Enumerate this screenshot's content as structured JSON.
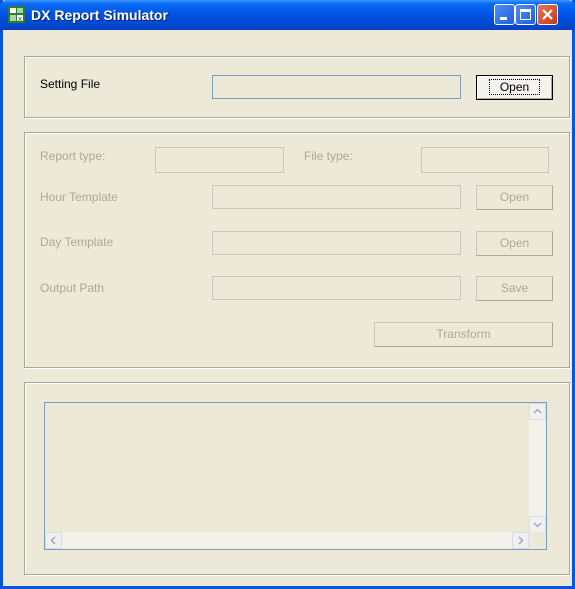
{
  "window": {
    "title": "DX Report Simulator"
  },
  "setting": {
    "label": "Setting File",
    "value": "",
    "open_label": "Open"
  },
  "options": {
    "report_type_label": "Report type:",
    "report_type_value": "",
    "file_type_label": "File type:",
    "file_type_value": "",
    "hour_template_label": "Hour Template",
    "hour_template_value": "",
    "hour_open_label": "Open",
    "day_template_label": "Day Template",
    "day_template_value": "",
    "day_open_label": "Open",
    "output_path_label": "Output Path",
    "output_path_value": "",
    "save_label": "Save",
    "transform_label": "Transform"
  },
  "log": {
    "text": ""
  }
}
